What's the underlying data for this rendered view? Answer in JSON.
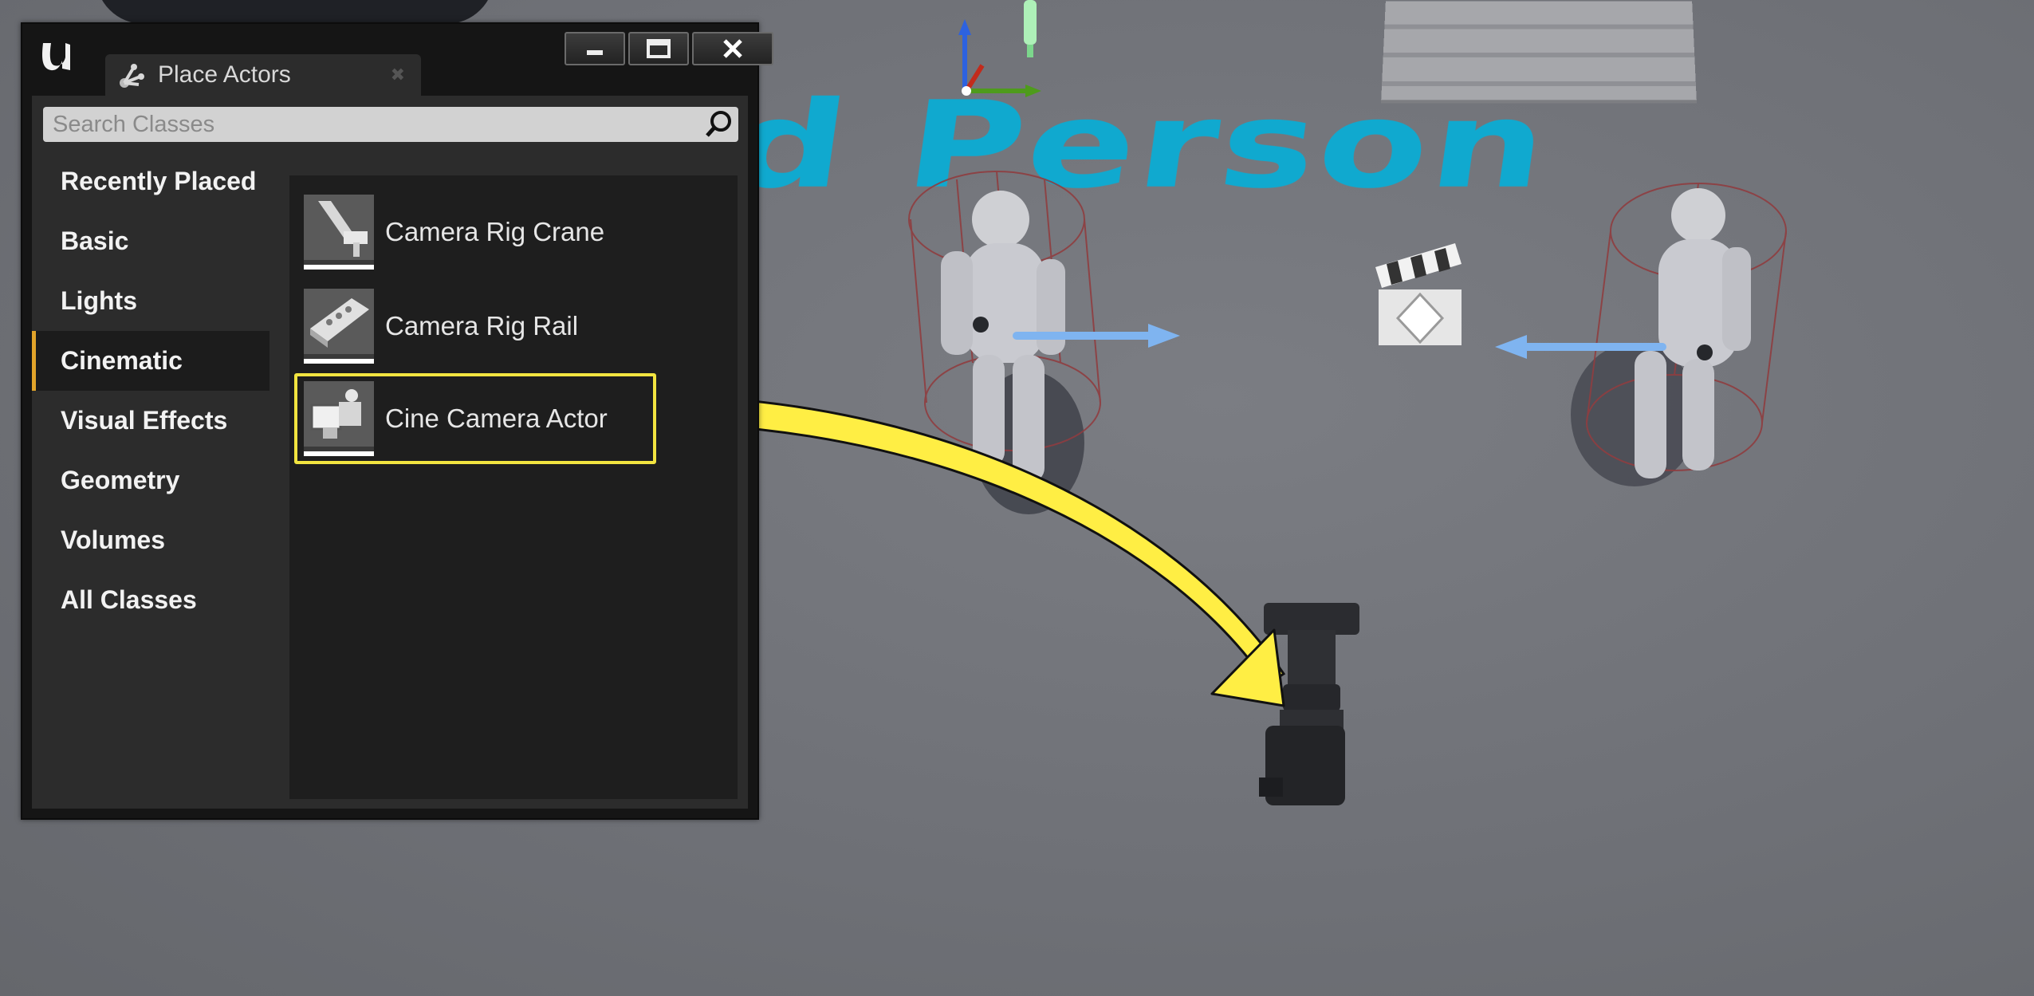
{
  "window": {
    "tab_title": "Place Actors"
  },
  "search": {
    "placeholder": "Search Classes"
  },
  "categories": [
    {
      "label": "Recently Placed"
    },
    {
      "label": "Basic"
    },
    {
      "label": "Lights"
    },
    {
      "label": "Cinematic"
    },
    {
      "label": "Visual Effects"
    },
    {
      "label": "Geometry"
    },
    {
      "label": "Volumes"
    },
    {
      "label": "All Classes"
    }
  ],
  "active_category": "Cinematic",
  "actors": [
    {
      "label": "Camera Rig Crane",
      "icon": "crane-icon"
    },
    {
      "label": "Camera Rig Rail",
      "icon": "rail-icon"
    },
    {
      "label": "Cine Camera Actor",
      "icon": "cine-camera-icon"
    }
  ],
  "selected_actor": "Cine Camera Actor",
  "viewport": {
    "floor_text": "d Person"
  },
  "colors": {
    "accent": "#e2a42a",
    "highlight": "#f2e440",
    "callout_arrow": "#ffee44",
    "floor_text": "#10a9cf"
  }
}
